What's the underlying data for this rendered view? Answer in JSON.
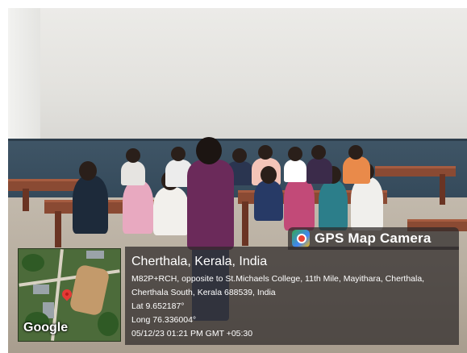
{
  "overlay": {
    "app_name": "GPS Map Camera",
    "location_title": "Cherthala, Kerala, India",
    "address_line1": "M82P+RCH, opposite to St.Michaels College, 11th Mile, Mayithara, Cherthala,",
    "address_line2": "Cherthala South, Kerala 688539, India",
    "latitude": "Lat 9.652187°",
    "longitude": "Long 76.336004°",
    "timestamp": "05/12/23 01:21 PM GMT +05:30",
    "map_attribution": "Google"
  },
  "colors": {
    "overlay_bg": "#2d2828",
    "wall_lower": "#3f5566",
    "bench": "#8a4a33",
    "teacher_top": "#6b2a5a",
    "pin": "#e53935"
  }
}
